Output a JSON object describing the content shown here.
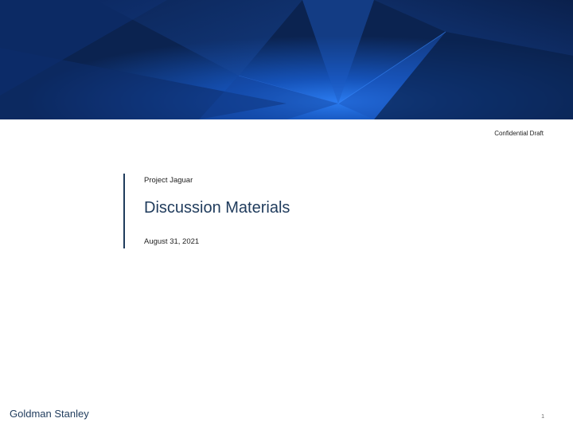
{
  "header": {
    "confidential_label": "Confidential Draft"
  },
  "title_block": {
    "project": "Project Jaguar",
    "title": "Discussion Materials",
    "date": "August 31, 2021"
  },
  "footer": {
    "company": "Goldman Stanley",
    "page_number": "1"
  },
  "colors": {
    "accent": "#1f3b5c",
    "banner_dark": "#0b2350",
    "banner_bright": "#1e6fe0"
  }
}
